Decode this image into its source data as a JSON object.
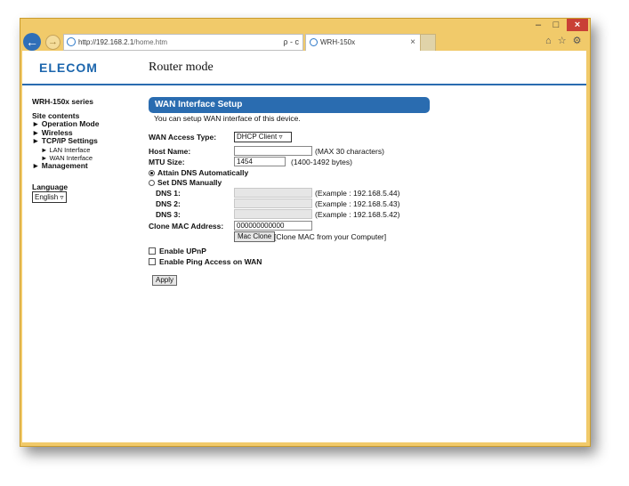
{
  "browser": {
    "address_host": "http://192.168.2.1",
    "address_path": "/home.htm",
    "address_tools": "ρ - c",
    "tab_title": "WRH-150x",
    "tab_close": "×",
    "window_buttons": {
      "minimize": "–",
      "maximize": "□",
      "close": "×"
    },
    "toolbar_icons": "⌂ ☆ ⚙"
  },
  "header": {
    "logo": "ELECOM",
    "mode_title": "Router mode"
  },
  "sidebar": {
    "series": "WRH-150x series",
    "site_contents": "Site contents",
    "items": {
      "operation_mode": "► Operation Mode",
      "wireless": "► Wireless",
      "tcpip": "► TCP/IP Settings",
      "lan": "► LAN Interface",
      "wan": "► WAN Interface",
      "management": "► Management"
    },
    "language_label": "Language",
    "language_value": "English"
  },
  "main": {
    "banner": "WAN Interface Setup",
    "description": "You can setup WAN interface of this device.",
    "access_type_label": "WAN Access Type:",
    "access_type_value": "DHCP Client",
    "host_name_label": "Host Name:",
    "host_name_value": "",
    "host_name_hint": "(MAX 30 characters)",
    "mtu_label": "MTU Size:",
    "mtu_value": "1454",
    "mtu_hint": "(1400-1492 bytes)",
    "dns_auto_label": "Attain DNS Automatically",
    "dns_manual_label": "Set DNS Manually",
    "dns1_label": "DNS 1:",
    "dns1_hint": "(Example : 192.168.5.44)",
    "dns2_label": "DNS 2:",
    "dns2_hint": "(Example : 192.168.5.43)",
    "dns3_label": "DNS 3:",
    "dns3_hint": "(Example : 192.168.5.42)",
    "clone_mac_label": "Clone MAC Address:",
    "clone_mac_value": "000000000000",
    "mac_clone_button": "Mac Clone",
    "mac_clone_hint": "[Clone MAC from your Computer]",
    "upnp_label": "Enable UPnP",
    "ping_label": "Enable Ping Access on WAN",
    "apply_button": "Apply"
  }
}
